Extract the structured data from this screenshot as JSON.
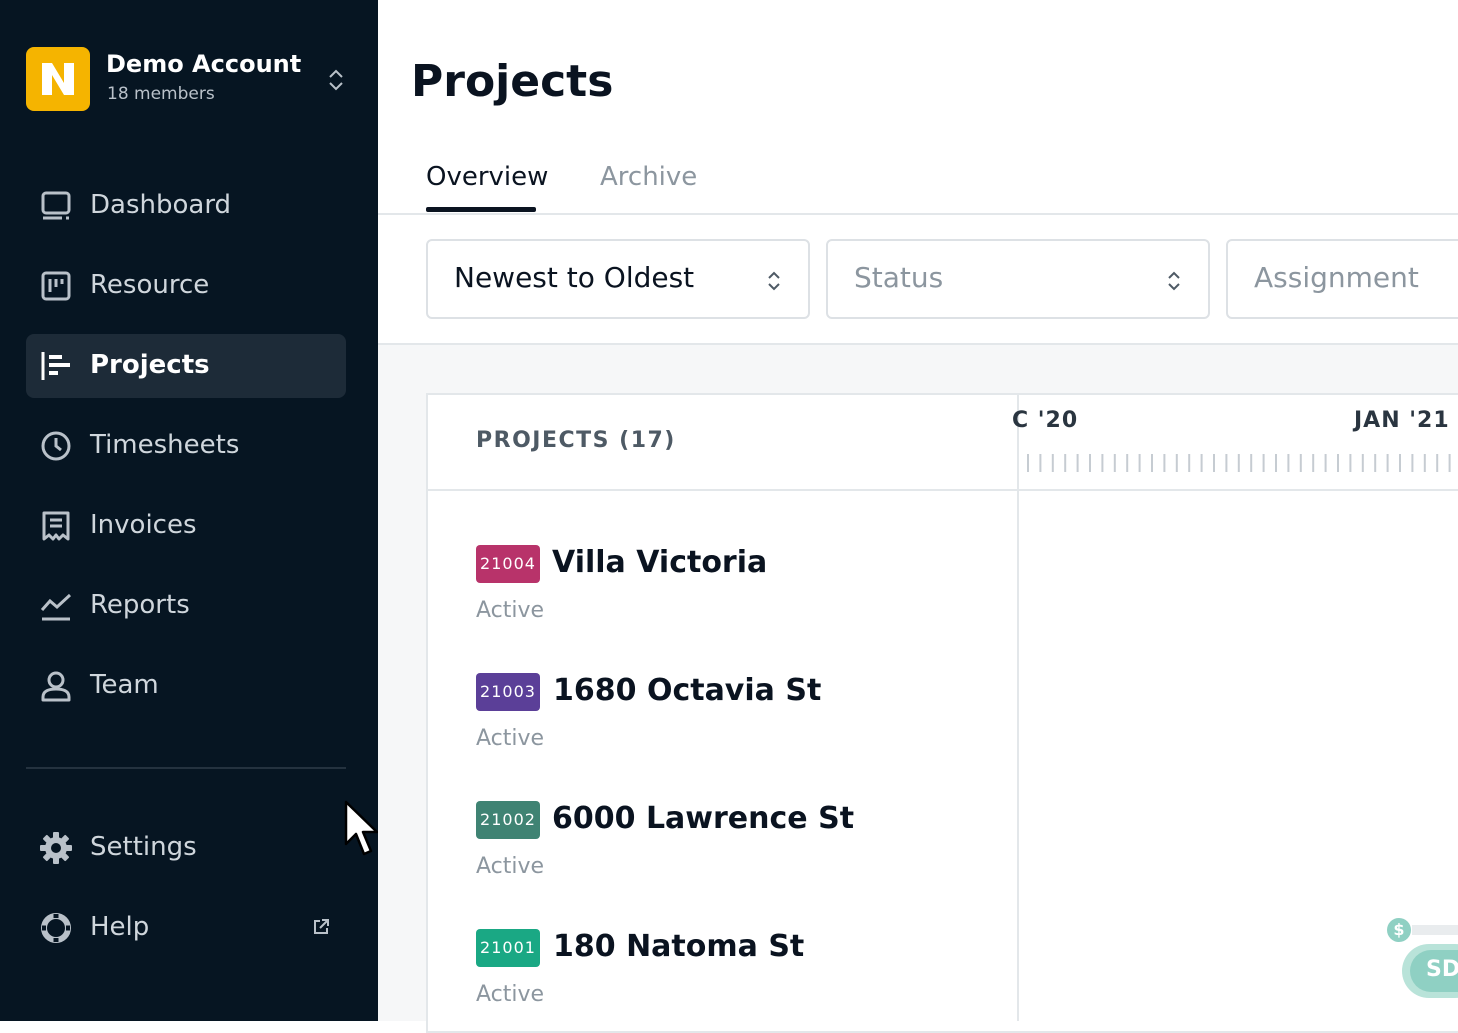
{
  "account": {
    "name": "Demo Account",
    "members": "18 members",
    "brand_color": "#f5b400"
  },
  "nav": [
    {
      "label": "Dashboard",
      "icon": "monitor-icon"
    },
    {
      "label": "Resource",
      "icon": "board-icon"
    },
    {
      "label": "Projects",
      "icon": "projects-icon",
      "active": true
    },
    {
      "label": "Timesheets",
      "icon": "clock-icon"
    },
    {
      "label": "Invoices",
      "icon": "invoice-icon"
    },
    {
      "label": "Reports",
      "icon": "chart-line-icon"
    },
    {
      "label": "Team",
      "icon": "person-icon"
    }
  ],
  "bottom_nav": [
    {
      "label": "Settings",
      "icon": "gear-icon"
    },
    {
      "label": "Help",
      "icon": "lifebuoy-icon",
      "external": "external-link-icon"
    }
  ],
  "page": {
    "title": "Projects"
  },
  "tabs": [
    {
      "label": "Overview",
      "active": true
    },
    {
      "label": "Archive"
    }
  ],
  "filters": {
    "sort": "Newest to Oldest",
    "status": "Status",
    "assignment": "Assignment"
  },
  "projects_panel": {
    "header": "PROJECTS (17)",
    "timeline": {
      "left": "C '20",
      "right": "JAN '21"
    },
    "rows": [
      {
        "code": "21004",
        "name": "Villa Victoria",
        "status": "Active",
        "color": "#b8336a"
      },
      {
        "code": "21003",
        "name": "1680 Octavia St",
        "status": "Active",
        "color": "#5b3f98"
      },
      {
        "code": "21002",
        "name": "6000 Lawrence St",
        "status": "Active",
        "color": "#3f8373"
      },
      {
        "code": "21001",
        "name": "180 Natoma St",
        "status": "Active",
        "color": "#1aa884"
      }
    ],
    "marker": {
      "symbol": "$",
      "chip": "SD"
    }
  }
}
